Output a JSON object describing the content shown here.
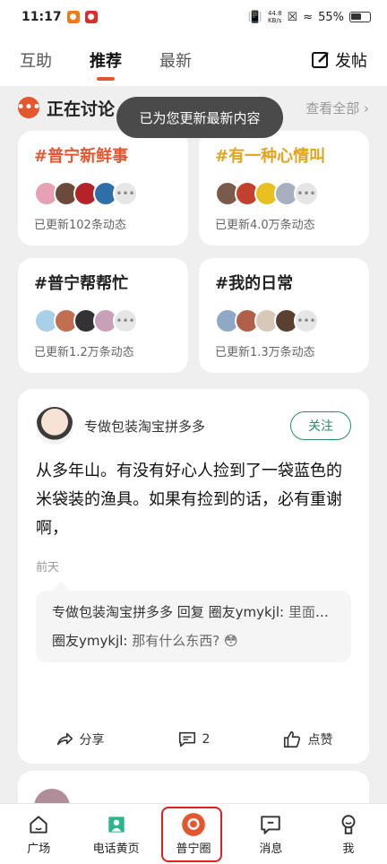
{
  "status_bar": {
    "time": "11:17",
    "net_speed_value": "44.8",
    "net_speed_unit": "KB/s",
    "battery": "55%"
  },
  "top_nav": {
    "tabs": [
      "互助",
      "推荐",
      "最新"
    ],
    "active_tab": 1,
    "post_label": "发帖"
  },
  "discussion": {
    "title": "正在讨论",
    "view_all": "查看全部"
  },
  "toast": "已为您更新最新内容",
  "topics": [
    {
      "title": "#普宁新鲜事",
      "color": "#e4572e",
      "sub": "已更新102条动态"
    },
    {
      "title": "#有一种心情叫",
      "color": "#e0a420",
      "sub": "已更新4.0万条动态"
    },
    {
      "title": "#普宁帮帮忙",
      "color": "#222222",
      "sub": "已更新1.2万条动态"
    },
    {
      "title": "#我的日常",
      "color": "#222222",
      "sub": "已更新1.3万条动态"
    }
  ],
  "post": {
    "author": "专做包装淘宝拼多多",
    "follow": "关注",
    "text": "从多年山。有没有好心人捡到了一袋蓝色的米袋装的渔具。如果有捡到的话，必有重谢啊，",
    "time": "前天",
    "reply1_author": "专做包装淘宝拼多多",
    "reply1_verb": "回复",
    "reply1_target": "圈友ymykjl:",
    "reply1_text": "里面装着鱼具还有镰力。各种东西全部在…",
    "reply2_author": "圈友ymykjl:",
    "reply2_text": "那有什么东西? 😳",
    "share": "分享",
    "comments": "2",
    "like": "点赞"
  },
  "bottom_nav": {
    "items": [
      "广场",
      "电话黄页",
      "普宁圈",
      "消息",
      "我"
    ],
    "active": 2
  },
  "colors": {
    "accent": "#e4572e",
    "follow_green": "#2a8d6e"
  }
}
